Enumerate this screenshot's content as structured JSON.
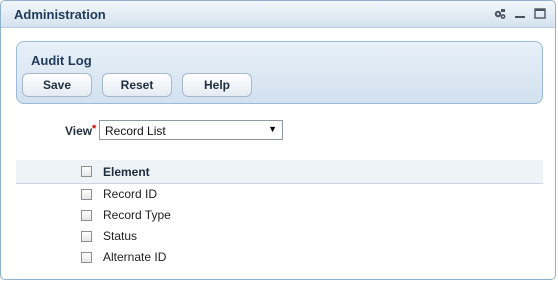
{
  "window": {
    "title": "Administration",
    "controls": [
      "settings-icon",
      "minimize-icon",
      "maximize-icon"
    ]
  },
  "panel": {
    "title": "Audit Log",
    "buttons": {
      "save": "Save",
      "reset": "Reset",
      "help": "Help"
    }
  },
  "view": {
    "label": "View",
    "required_mark": "*",
    "selected": "Record List"
  },
  "table": {
    "header": "Element",
    "rows": [
      "Record ID",
      "Record Type",
      "Status",
      "Alternate ID"
    ]
  },
  "colors": {
    "accent": "#1f3a5a",
    "panel_bg": "#d2e1ef",
    "required": "#d00000"
  }
}
